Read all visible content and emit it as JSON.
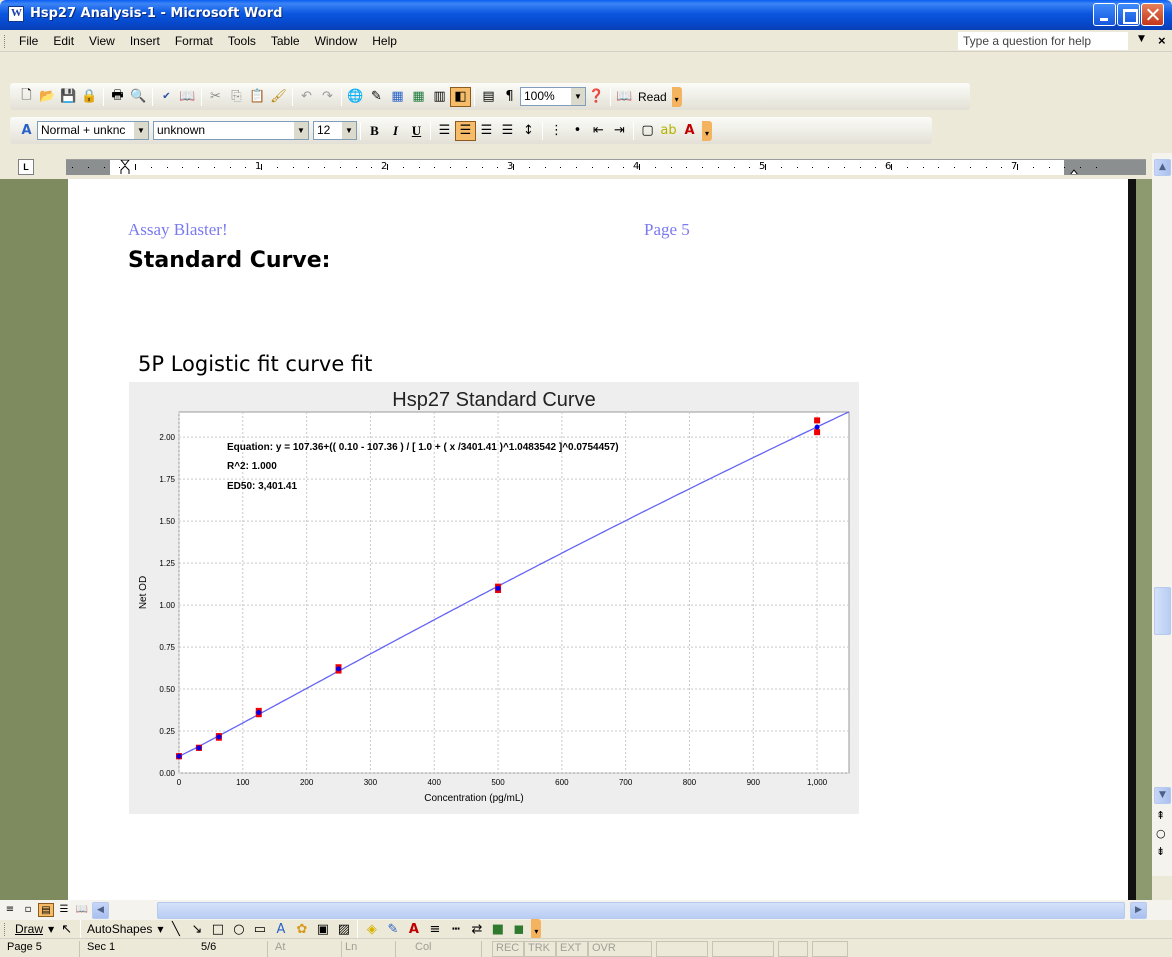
{
  "window": {
    "title": "Hsp27 Analysis-1 - Microsoft Word"
  },
  "menu": {
    "items": [
      "File",
      "Edit",
      "View",
      "Insert",
      "Format",
      "Tools",
      "Table",
      "Window",
      "Help"
    ],
    "help_placeholder": "Type a question for help"
  },
  "standard_toolbar": {
    "zoom": "100%",
    "read_label": "Read"
  },
  "formatting_toolbar": {
    "style": "Normal + unknc",
    "font": "unknown",
    "size": "12"
  },
  "ruler": {
    "numbers": [
      "1",
      "2",
      "3",
      "4",
      "5",
      "6",
      "7"
    ]
  },
  "document": {
    "header_left": "Assay Blaster!",
    "header_right": "Page 5",
    "heading": "Standard Curve:",
    "subheading": "5P Logistic fit curve fit"
  },
  "chart_data": {
    "type": "scatter",
    "title": "Hsp27 Standard Curve",
    "xlabel": "Concentration (pg/mL)",
    "ylabel": "Net OD",
    "xlim": [
      0,
      1050
    ],
    "ylim": [
      0,
      2.15
    ],
    "xticks": [
      0,
      100,
      200,
      300,
      400,
      500,
      600,
      700,
      800,
      900,
      1000
    ],
    "xtick_labels": [
      "0",
      "100",
      "200",
      "300",
      "400",
      "500",
      "600",
      "700",
      "800",
      "900",
      "1,000"
    ],
    "yticks": [
      0,
      0.25,
      0.5,
      0.75,
      1.0,
      1.25,
      1.5,
      1.75,
      2.0
    ],
    "ytick_labels": [
      "0.00",
      "0.25",
      "0.50",
      "0.75",
      "1.00",
      "1.25",
      "1.50",
      "1.75",
      "2.00"
    ],
    "grid": true,
    "annotations": [
      "Equation: y = 107.36+(( 0.10 - 107.36 ) / [ 1.0 + ( x /3401.41 )^1.0483542 ]^0.0754457)",
      "R^2: 1.000",
      "ED50: 3,401.41"
    ],
    "fit": {
      "A": 107.36,
      "D": 0.1,
      "C": 3401.41,
      "B": 1.0483542,
      "E": 0.0754457
    },
    "replicates": {
      "x": [
        0,
        31.25,
        62.5,
        125,
        250,
        500,
        1000
      ],
      "y1": [
        0.1,
        0.15,
        0.22,
        0.37,
        0.63,
        1.11,
        2.1
      ],
      "y2": [
        0.1,
        0.15,
        0.21,
        0.35,
        0.61,
        1.09,
        2.03
      ]
    },
    "means": {
      "x": [
        0,
        31.25,
        62.5,
        125,
        250,
        500,
        1000
      ],
      "y": [
        0.1,
        0.15,
        0.215,
        0.36,
        0.62,
        1.1,
        2.06
      ]
    },
    "colors": {
      "fit": "#6464f5",
      "replicate": "#ee0000",
      "mean": "#0000ee"
    }
  },
  "statusbar": {
    "page": "Page 5",
    "sec": "Sec 1",
    "count": "5/6",
    "at": "At",
    "ln": "Ln",
    "col": "Col",
    "rec": "REC",
    "trk": "TRK",
    "ext": "EXT",
    "ovr": "OVR"
  },
  "drawing_toolbar": {
    "draw_label": "Draw",
    "autoshapes_label": "AutoShapes"
  }
}
